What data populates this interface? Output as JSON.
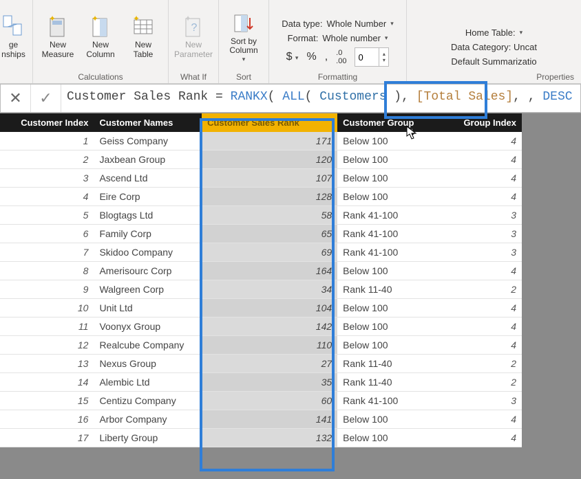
{
  "ribbon": {
    "manage_group_lines": {
      "l1": "ge",
      "l2": "nships"
    },
    "calc": {
      "measure": {
        "l1": "New",
        "l2": "Measure"
      },
      "column": {
        "l1": "New",
        "l2": "Column"
      },
      "table": {
        "l1": "New",
        "l2": "Table"
      },
      "label": "Calculations"
    },
    "whatif": {
      "param": {
        "l1": "New",
        "l2": "Parameter"
      },
      "label": "What If"
    },
    "sort": {
      "btn": {
        "l1": "Sort by",
        "l2": "Column"
      },
      "label": "Sort"
    },
    "formatting": {
      "dtype_label": "Data type:",
      "dtype_value": "Whole Number",
      "format_label": "Format:",
      "format_value": "Whole number",
      "dollar": "$",
      "percent": "%",
      "comma": ",",
      "precision_icon": ".00",
      "precision_value": "0",
      "label": "Formatting"
    },
    "properties": {
      "home_table": "Home Table:",
      "data_cat": "Data Category: Uncat",
      "def_summ": "Default Summarizatio",
      "label": "Properties"
    }
  },
  "formula": {
    "lhs": "Customer Sales Rank",
    "eq": " = ",
    "fn": "RANKX",
    "p1": "( ",
    "fn2": "ALL",
    "p2": "( ",
    "tbl": "Customers",
    "p3": " ), ",
    "meas": "[Total Sales]",
    "p4": ", ",
    "sep": ", ",
    "kw": "DESC",
    "p5": " )"
  },
  "columns": {
    "idx": "Customer Index",
    "name": "Customer Names",
    "rank": "Customer Sales Rank",
    "grp": "Customer Group",
    "gidx": "Group Index"
  },
  "rows": [
    {
      "idx": 1,
      "name": "Geiss Company",
      "rank": 171,
      "grp": "Below 100",
      "gidx": 4
    },
    {
      "idx": 2,
      "name": "Jaxbean Group",
      "rank": 120,
      "grp": "Below 100",
      "gidx": 4
    },
    {
      "idx": 3,
      "name": "Ascend Ltd",
      "rank": 107,
      "grp": "Below 100",
      "gidx": 4
    },
    {
      "idx": 4,
      "name": "Eire Corp",
      "rank": 128,
      "grp": "Below 100",
      "gidx": 4
    },
    {
      "idx": 5,
      "name": "Blogtags Ltd",
      "rank": 58,
      "grp": "Rank 41-100",
      "gidx": 3
    },
    {
      "idx": 6,
      "name": "Family Corp",
      "rank": 65,
      "grp": "Rank 41-100",
      "gidx": 3
    },
    {
      "idx": 7,
      "name": "Skidoo Company",
      "rank": 69,
      "grp": "Rank 41-100",
      "gidx": 3
    },
    {
      "idx": 8,
      "name": "Amerisourc Corp",
      "rank": 164,
      "grp": "Below 100",
      "gidx": 4
    },
    {
      "idx": 9,
      "name": "Walgreen Corp",
      "rank": 34,
      "grp": "Rank 11-40",
      "gidx": 2
    },
    {
      "idx": 10,
      "name": "Unit Ltd",
      "rank": 104,
      "grp": "Below 100",
      "gidx": 4
    },
    {
      "idx": 11,
      "name": "Voonyx Group",
      "rank": 142,
      "grp": "Below 100",
      "gidx": 4
    },
    {
      "idx": 12,
      "name": "Realcube Company",
      "rank": 110,
      "grp": "Below 100",
      "gidx": 4
    },
    {
      "idx": 13,
      "name": "Nexus Group",
      "rank": 27,
      "grp": "Rank 11-40",
      "gidx": 2
    },
    {
      "idx": 14,
      "name": "Alembic Ltd",
      "rank": 35,
      "grp": "Rank 11-40",
      "gidx": 2
    },
    {
      "idx": 15,
      "name": "Centizu Company",
      "rank": 60,
      "grp": "Rank 41-100",
      "gidx": 3
    },
    {
      "idx": 16,
      "name": "Arbor Company",
      "rank": 141,
      "grp": "Below 100",
      "gidx": 4
    },
    {
      "idx": 17,
      "name": "Liberty Group",
      "rank": 132,
      "grp": "Below 100",
      "gidx": 4
    }
  ]
}
